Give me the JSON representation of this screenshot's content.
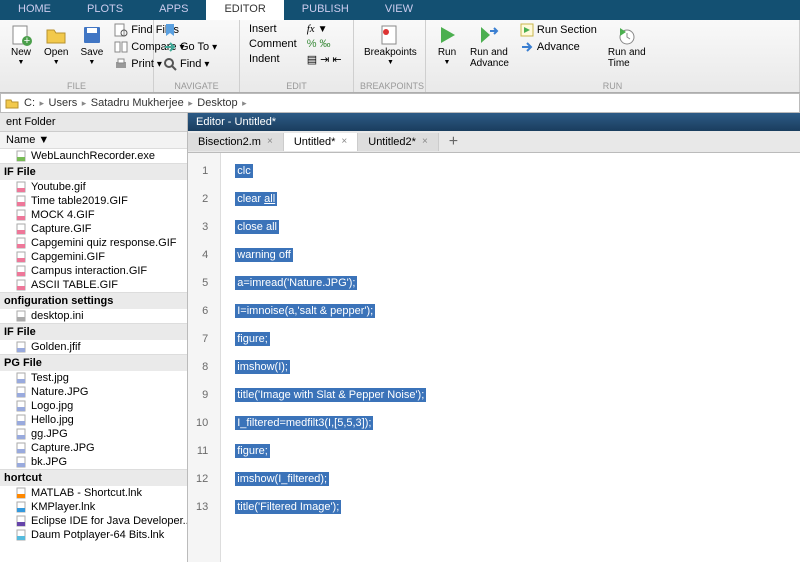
{
  "tabs": [
    "HOME",
    "PLOTS",
    "APPS",
    "EDITOR",
    "PUBLISH",
    "VIEW"
  ],
  "active_tab": "EDITOR",
  "ribbon": {
    "file": {
      "label": "FILE",
      "new": "New",
      "open": "Open",
      "save": "Save",
      "find_files": "Find Files",
      "compare": "Compare",
      "print": "Print"
    },
    "navigate": {
      "label": "NAVIGATE",
      "goto": "Go To",
      "find": "Find",
      "bookmark": "Bookmark"
    },
    "edit": {
      "label": "EDIT",
      "insert": "Insert",
      "comment": "Comment",
      "indent": "Indent",
      "fx": "fx"
    },
    "breakpoints": {
      "label": "BREAKPOINTS",
      "breakpoints": "Breakpoints"
    },
    "run": {
      "label": "RUN",
      "run": "Run",
      "run_advance": "Run and\nAdvance",
      "run_section": "Run Section",
      "advance": "Advance",
      "run_time": "Run and\nTime"
    }
  },
  "breadcrumb": [
    "C:",
    "Users",
    "Satadru Mukherjee",
    "Desktop"
  ],
  "sidebar": {
    "header": "ent Folder",
    "name_col": "Name",
    "groups": [
      {
        "cat": "",
        "items": [
          {
            "t": "WebLaunchRecorder.exe",
            "i": "exe"
          }
        ]
      },
      {
        "cat": "IF File",
        "items": [
          {
            "t": "Youtube.gif",
            "i": "gif"
          },
          {
            "t": "Time table2019.GIF",
            "i": "gif"
          },
          {
            "t": "MOCK 4.GIF",
            "i": "gif"
          },
          {
            "t": "Capture.GIF",
            "i": "gif"
          },
          {
            "t": "Capgemini quiz response.GIF",
            "i": "gif"
          },
          {
            "t": "Capgemini.GIF",
            "i": "gif"
          },
          {
            "t": "Campus interaction.GIF",
            "i": "gif"
          },
          {
            "t": "ASCII TABLE.GIF",
            "i": "gif"
          }
        ]
      },
      {
        "cat": "onfiguration settings",
        "items": [
          {
            "t": "desktop.ini",
            "i": "ini"
          }
        ]
      },
      {
        "cat": "IF File",
        "items": [
          {
            "t": "Golden.jfif",
            "i": "jfif"
          }
        ]
      },
      {
        "cat": "PG File",
        "items": [
          {
            "t": "Test.jpg",
            "i": "jpg"
          },
          {
            "t": "Nature.JPG",
            "i": "jpg"
          },
          {
            "t": "Logo.jpg",
            "i": "jpg"
          },
          {
            "t": "Hello.jpg",
            "i": "jpg"
          },
          {
            "t": "gg.JPG",
            "i": "jpg"
          },
          {
            "t": "Capture.JPG",
            "i": "jpg"
          },
          {
            "t": "bk.JPG",
            "i": "jpg"
          }
        ]
      },
      {
        "cat": "hortcut",
        "items": [
          {
            "t": "MATLAB - Shortcut.lnk",
            "i": "matlab"
          },
          {
            "t": "KMPlayer.lnk",
            "i": "km"
          },
          {
            "t": "Eclipse IDE for Java Developer...",
            "i": "eclipse"
          },
          {
            "t": "Daum Potplayer-64 Bits.lnk",
            "i": "pot"
          }
        ]
      }
    ]
  },
  "editor": {
    "title": "Editor - Untitled*",
    "tabs": [
      {
        "name": "Bisection2.m",
        "dirty": false
      },
      {
        "name": "Untitled*",
        "dirty": true,
        "active": true
      },
      {
        "name": "Untitled2*",
        "dirty": true
      }
    ],
    "lines": [
      "clc",
      "clear all",
      "close all",
      "warning off",
      "a=imread('Nature.JPG');",
      "I=imnoise(a,'salt & pepper');",
      "figure;",
      "imshow(I);",
      "title('Image with Slat & Pepper Noise');",
      "I_filtered=medfilt3(I,[5,5,3]);",
      "figure;",
      "imshow(I_filtered);",
      "title('Filtered Image');"
    ]
  }
}
